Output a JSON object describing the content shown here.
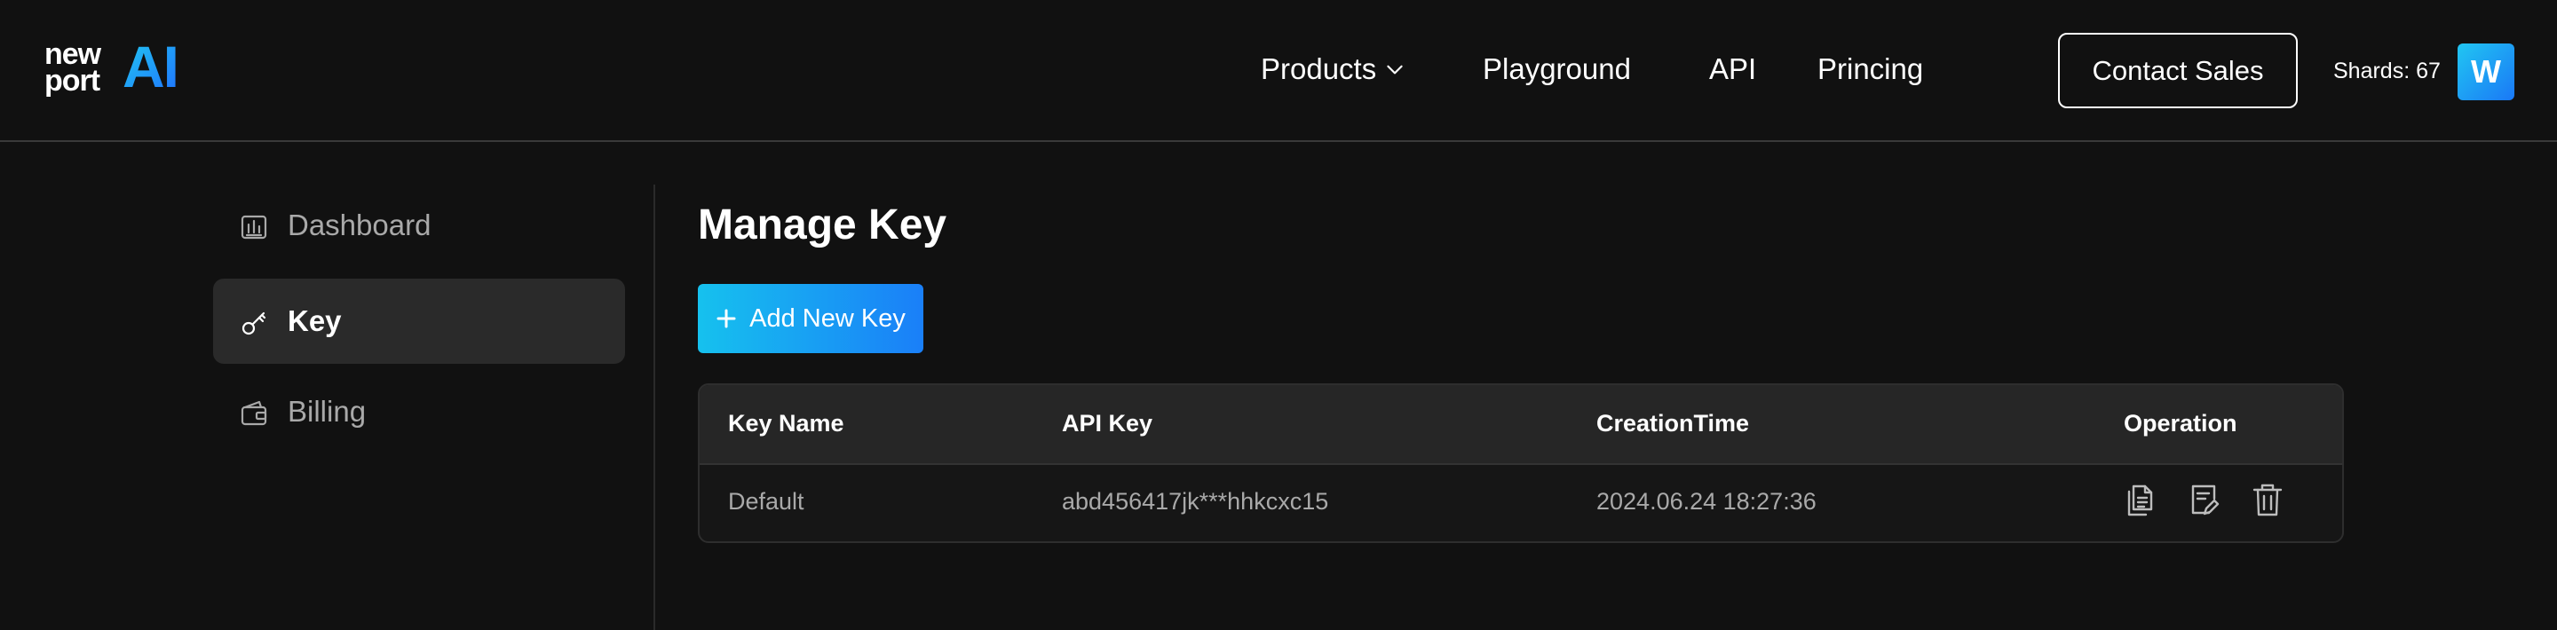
{
  "brand": {
    "line1": "new",
    "line2": "port",
    "ai": "AI"
  },
  "nav": {
    "products": "Products",
    "playground": "Playground",
    "api": "API",
    "pricing": "Princing"
  },
  "header": {
    "contact_sales": "Contact Sales",
    "shards": "Shards: 67",
    "avatar_letter": "W"
  },
  "sidebar": {
    "items": [
      {
        "label": "Dashboard",
        "icon": "dashboard-icon"
      },
      {
        "label": "Key",
        "icon": "key-icon",
        "active": true
      },
      {
        "label": "Billing",
        "icon": "wallet-icon"
      }
    ]
  },
  "main": {
    "title": "Manage Key",
    "add_button": "Add New Key",
    "table": {
      "headers": [
        "Key Name",
        "API Key",
        "CreationTime",
        "Operation"
      ],
      "rows": [
        {
          "name": "Default",
          "api_key": "abd456417jk***hhkcxc15",
          "created": "2024.06.24 18:27:36",
          "operations": [
            "copy-icon",
            "edit-icon",
            "delete-icon"
          ]
        }
      ]
    }
  },
  "colors": {
    "background": "#111111",
    "accent_start": "#16c1ee",
    "accent_end": "#1a7ff8",
    "active_item": "#2a2a2a"
  }
}
